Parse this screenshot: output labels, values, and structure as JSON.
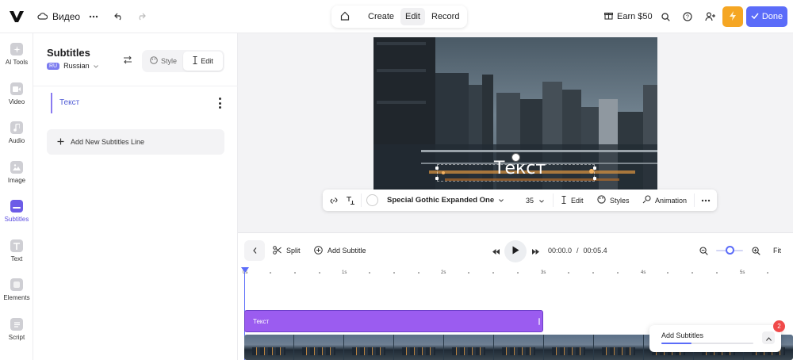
{
  "topbar": {
    "project_name": "Видео",
    "modes": [
      "Create",
      "Edit",
      "Record"
    ],
    "active_mode": "Edit",
    "earn_label": "Earn $50",
    "done_label": "Done"
  },
  "rail": {
    "items": [
      {
        "label": "AI Tools",
        "icon": "sparkle-icon"
      },
      {
        "label": "Video",
        "icon": "video-icon"
      },
      {
        "label": "Audio",
        "icon": "music-icon"
      },
      {
        "label": "Image",
        "icon": "image-icon"
      },
      {
        "label": "Subtitles",
        "icon": "subtitles-icon",
        "active": true
      },
      {
        "label": "Text",
        "icon": "text-icon"
      },
      {
        "label": "Elements",
        "icon": "elements-icon"
      },
      {
        "label": "Script",
        "icon": "script-icon"
      }
    ]
  },
  "panel": {
    "title": "Subtitles",
    "lang_code": "RU",
    "lang_name": "Russian",
    "tabs": [
      "Style",
      "Edit"
    ],
    "active_tab": "Edit",
    "lines": [
      {
        "text": "Текст"
      }
    ],
    "add_line_label": "Add New Subtitles Line"
  },
  "preview": {
    "subtitle_text": "Текст"
  },
  "text_toolbar": {
    "font_name": "Special Gothic Expanded One",
    "font_size": "35",
    "edit_label": "Edit",
    "styles_label": "Styles",
    "animation_label": "Animation"
  },
  "timeline": {
    "split_label": "Split",
    "add_subtitle_label": "Add Subtitle",
    "current_time": "00:00.0",
    "separator": "/",
    "total_time": "00:05.4",
    "fit_label": "Fit",
    "ticks": [
      "0s",
      "1s",
      "2s",
      "3s",
      "4s",
      "5s"
    ],
    "clip_text": "Текст"
  },
  "toast": {
    "label": "Add Subtitles",
    "progress": 0.33,
    "badge_count": "2"
  },
  "colors": {
    "accent": "#5b6cf9",
    "clip": "#9b5cf0",
    "bolt": "#f5a623"
  }
}
